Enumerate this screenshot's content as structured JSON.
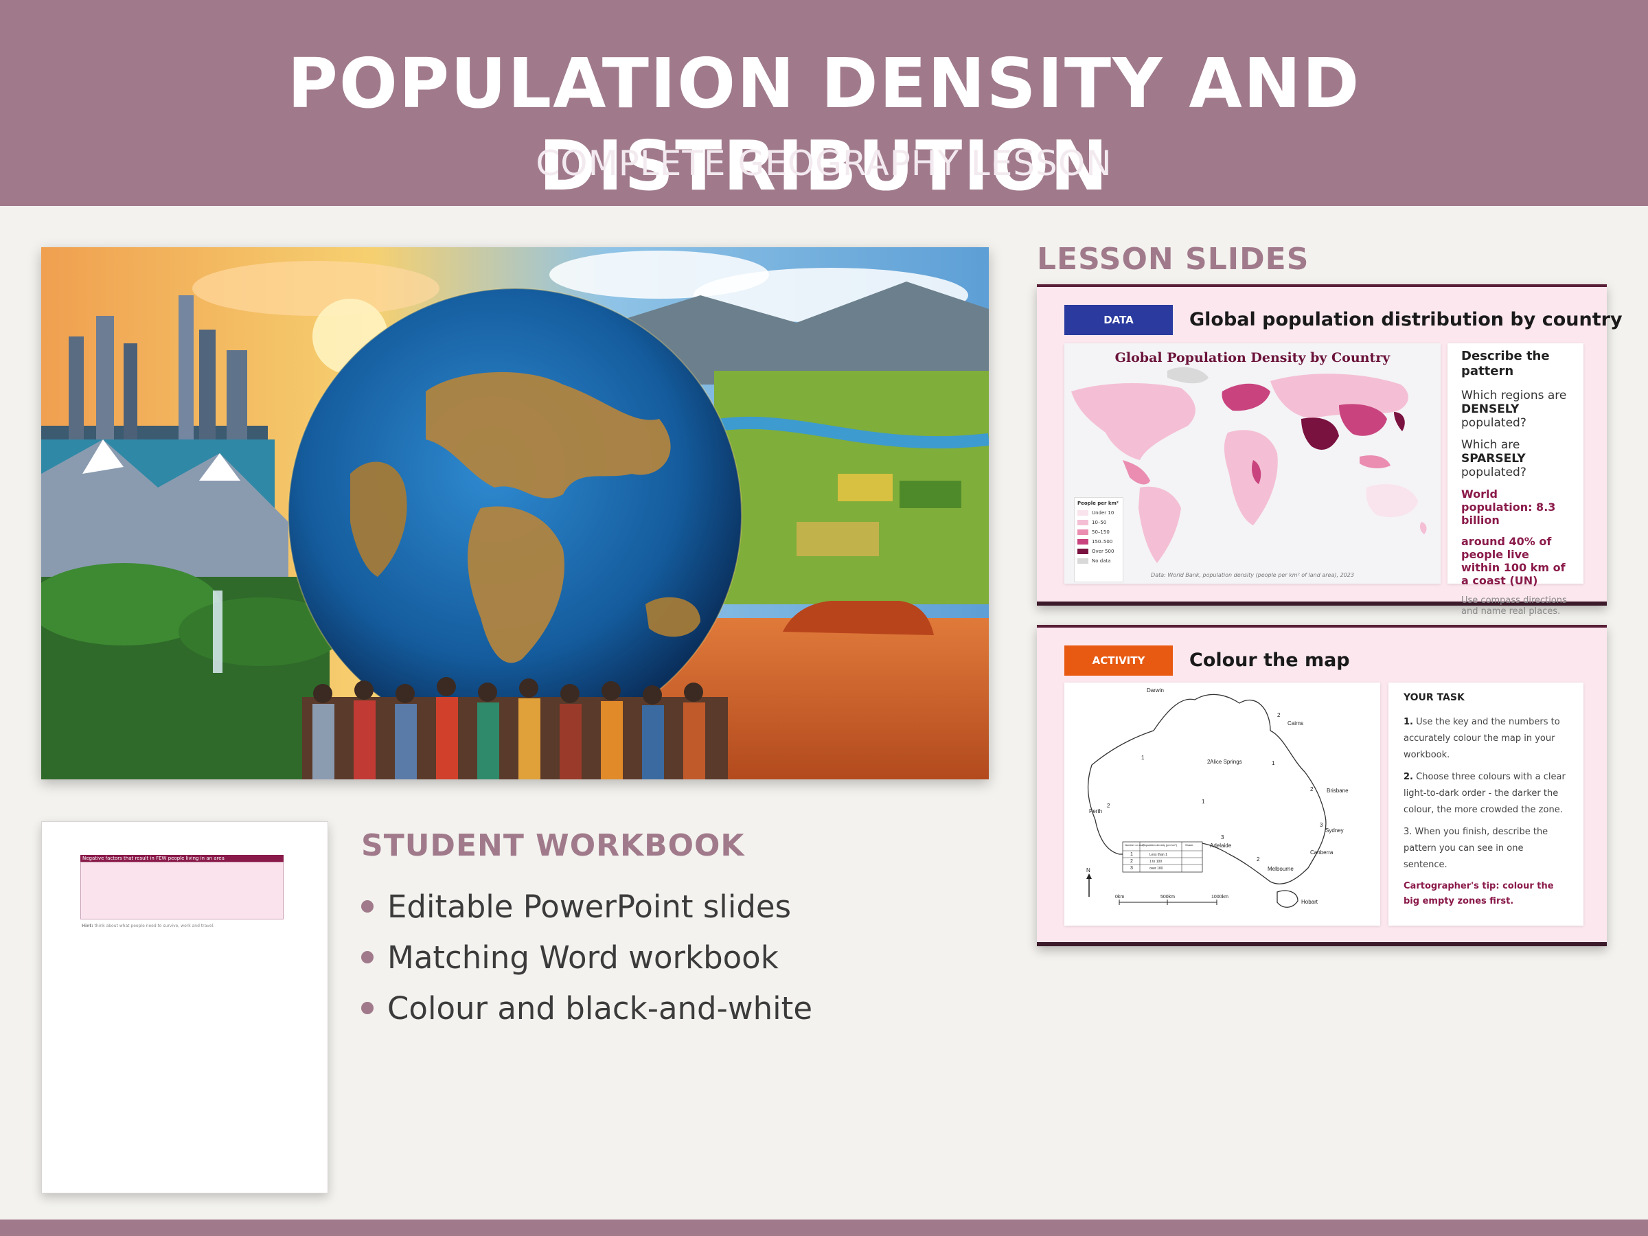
{
  "header": {
    "title": "POPULATION DENSITY AND DISTRIBUTION",
    "subtitle": "COMPLETE GEOGRAPHY LESSON"
  },
  "workbook": {
    "heading": "STUDENT WORKBOOK",
    "page_bar": "Negative factors that result in FEW people living in an area",
    "page_hint_label": "Hint:",
    "page_hint": "think about what people need to survive, work and travel.",
    "features": [
      "Editable PowerPoint slides",
      "Matching Word workbook",
      "Colour and black-and-white"
    ]
  },
  "lesson_slides": {
    "heading": "LESSON SLIDES",
    "slide1": {
      "tag": "DATA",
      "title": "Global population distribution by country",
      "map_title": "Global Population Density by Country",
      "source": "Data: World Bank, population density (people per km² of land area), 2023",
      "key_title": "People per km²",
      "key": [
        {
          "label": "Under 10",
          "color": "#f9e3ec"
        },
        {
          "label": "10–50",
          "color": "#f4bfd4"
        },
        {
          "label": "50–150",
          "color": "#ea8db1"
        },
        {
          "label": "150–500",
          "color": "#c9447f"
        },
        {
          "label": "Over 500",
          "color": "#7a1240"
        },
        {
          "label": "No data",
          "color": "#d9d9d9"
        }
      ],
      "side_heading": "Describe the pattern",
      "q1_prefix": "Which regions are",
      "q1_bold": "DENSELY",
      "q1_suffix": "populated?",
      "q2_prefix": "Which are",
      "q2_bold": "SPARSELY",
      "q2_suffix": "populated?",
      "fact1": "World population: 8.3 billion",
      "fact2": "around 40% of people live within 100 km of a coast (UN)",
      "note": "Use compass directions and name real places."
    },
    "slide2": {
      "tag": "ACTIVITY",
      "title": "Colour the map",
      "task_heading": "YOUR TASK",
      "step1_num": "1.",
      "step1": "Use the key and the numbers to accurately colour the map in your workbook.",
      "step2_num": "2.",
      "step2": "Choose three colours with a clear light-to-dark order - the darker the colour, the more crowded the zone.",
      "step3": "3. When you finish, describe the pattern you can see in one sentence.",
      "tip": "Cartographer's tip: colour the big empty zones first.",
      "cities": [
        "Darwin",
        "Cairns",
        "Alice Springs",
        "Brisbane",
        "Perth",
        "Sydney",
        "Adelaide",
        "Canberra",
        "Melbourne",
        "Hobart"
      ],
      "table_headers": [
        "Number on map",
        "Population density (per km²)",
        "Shade"
      ],
      "table_rows": [
        [
          "1",
          "Less than 1"
        ],
        [
          "2",
          "1 to 100"
        ],
        [
          "3",
          "over 100"
        ]
      ],
      "scale": [
        "0km",
        "500km",
        "1000km"
      ],
      "north": "N"
    }
  },
  "colors": {
    "brand": "#a07a8b",
    "accent": "#8a1a4a",
    "data_tag": "#2a3a9e",
    "activity_tag": "#e85a12"
  }
}
